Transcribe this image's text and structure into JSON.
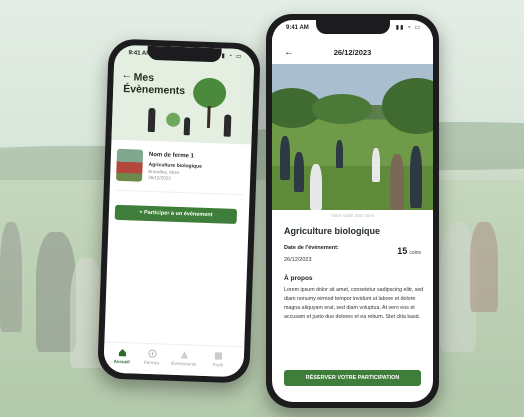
{
  "left_phone": {
    "status_time": "9:41 AM",
    "status_icons": "▮▮ ◔ ▭",
    "back_symbol": "←",
    "title_line1": "Mes",
    "title_line2": "Évènements",
    "farm": {
      "name": "Nom de ferme 1",
      "type": "Agriculture biologique",
      "location": "Bruxelles, Ittres",
      "date": "26/12/2023"
    },
    "join_button": "+ Participer à un évènement",
    "tabs": [
      {
        "label": "Accueil",
        "icon": "home-icon",
        "active": true
      },
      {
        "label": "Fermes",
        "icon": "compass-icon",
        "active": false
      },
      {
        "label": "Évènements",
        "icon": "event-icon",
        "active": false
      },
      {
        "label": "Profil",
        "icon": "profile-icon",
        "active": false
      }
    ]
  },
  "right_phone": {
    "status_time": "9:41 AM",
    "status_icons": "▮▮ ◔ ▭",
    "back_symbol": "←",
    "title": "26/12/2023",
    "balance_text": "Votre solde 300 coins",
    "event_title": "Agriculture biologique",
    "date_label": "Date de l'évènement:",
    "date_value": "26/12/2023",
    "coins_value": "15",
    "coins_unit": "coins",
    "about_title": "À propos",
    "about_text": "Lorem ipsum dolor sit amet, consetetur sadipscing elitr, sed diam nonumy eirmod tempor invidunt ut labore et dolore magna aliquyam erat, sed diam voluptua. At vero eos et accusam et justo duo dolores et ea rebum. Stet clita kasd.",
    "reserve_button": "RÉSERVER VOTRE PARTICIPATION"
  },
  "colors": {
    "accent_green": "#3f7d3a",
    "dark_frame": "#1c1c1e",
    "hero_bg": "#e4efe1"
  }
}
